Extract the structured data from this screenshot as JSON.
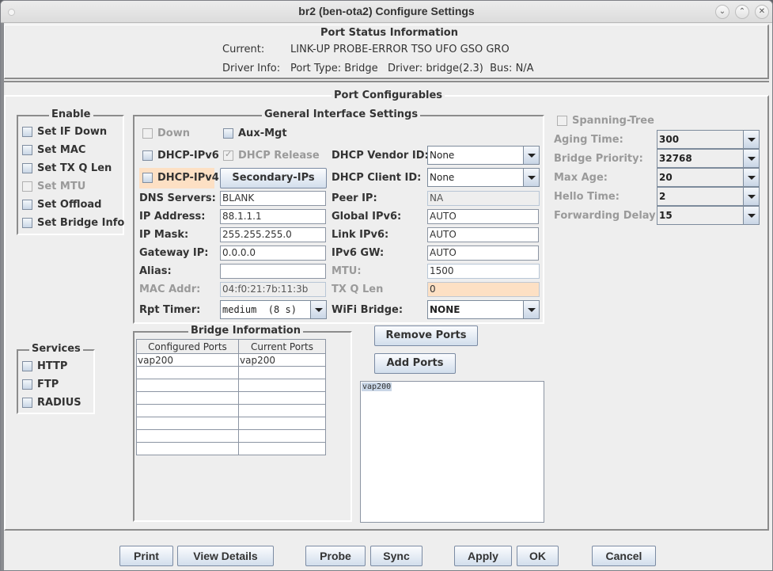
{
  "window": {
    "title": "br2  (ben-ota2) Configure Settings",
    "controls": {
      "minimize": "⌄",
      "maximize": "⌃",
      "close": "✕"
    }
  },
  "port_status": {
    "title": "Port Status Information",
    "current_label": "Current:",
    "current_value": "LINK-UP PROBE-ERROR TSO UFO GSO GRO",
    "driver_label": "Driver Info:",
    "driver_value": "Port Type: Bridge   Driver: bridge(2.3)  Bus: N/A"
  },
  "configurables": {
    "title": "Port Configurables",
    "enable": {
      "title": "Enable",
      "items": [
        {
          "label": "Set IF Down",
          "checked": false,
          "disabled": false
        },
        {
          "label": "Set MAC",
          "checked": false,
          "disabled": false
        },
        {
          "label": "Set TX Q Len",
          "checked": false,
          "disabled": false
        },
        {
          "label": "Set MTU",
          "checked": false,
          "disabled": true
        },
        {
          "label": "Set Offload",
          "checked": false,
          "disabled": false
        },
        {
          "label": "Set Bridge Info",
          "checked": false,
          "disabled": false
        }
      ]
    },
    "services": {
      "title": "Services",
      "items": [
        {
          "label": "HTTP",
          "checked": false
        },
        {
          "label": "FTP",
          "checked": false
        },
        {
          "label": "RADIUS",
          "checked": false
        }
      ]
    },
    "general": {
      "title": "General Interface Settings",
      "down": "Down",
      "aux_mgt": "Aux-Mgt",
      "dhcp_ipv6": "DHCP-IPv6",
      "dhcp_release": "DHCP Release",
      "dhcp_ipv4": "DHCP-IPv4",
      "secondary_ips": "Secondary-IPs",
      "dhcp_vendor_id_label": "DHCP Vendor ID:",
      "dhcp_vendor_id": "None",
      "dhcp_client_id_label": "DHCP Client ID:",
      "dhcp_client_id": "None",
      "dns_label": "DNS Servers:",
      "dns": "BLANK",
      "peer_ip_label": "Peer IP:",
      "peer_ip": "NA",
      "ip_label": "IP Address:",
      "ip": "88.1.1.1",
      "global_ipv6_label": "Global IPv6:",
      "global_ipv6": "AUTO",
      "mask_label": "IP Mask:",
      "mask": "255.255.255.0",
      "link_ipv6_label": "Link IPv6:",
      "link_ipv6": "AUTO",
      "gateway_label": "Gateway IP:",
      "gateway": "0.0.0.0",
      "ipv6_gw_label": "IPv6 GW:",
      "ipv6_gw": "AUTO",
      "alias_label": "Alias:",
      "alias": "",
      "mtu_label": "MTU:",
      "mtu": "1500",
      "mac_label": "MAC Addr:",
      "mac": "04:f0:21:7b:11:3b",
      "txq_label": "TX Q Len",
      "txq": "0",
      "rpt_timer_label": "Rpt Timer:",
      "rpt_timer": "medium  (8 s)",
      "wifi_bridge_label": "WiFi Bridge:",
      "wifi_bridge": "NONE"
    },
    "spanning_tree": {
      "label": "Spanning-Tree",
      "aging_time_label": "Aging Time:",
      "aging_time": "300",
      "bridge_priority_label": "Bridge Priority:",
      "bridge_priority": "32768",
      "max_age_label": "Max Age:",
      "max_age": "20",
      "hello_time_label": "Hello Time:",
      "hello_time": "2",
      "forwarding_delay_label": "Forwarding Delay:",
      "forwarding_delay": "15"
    },
    "bridge_info": {
      "title": "Bridge Information",
      "columns": [
        "Configured Ports",
        "Current Ports"
      ],
      "rows": [
        [
          "vap200",
          "vap200"
        ],
        [
          "",
          ""
        ],
        [
          "",
          ""
        ],
        [
          "",
          ""
        ],
        [
          "",
          ""
        ],
        [
          "",
          ""
        ],
        [
          "",
          ""
        ],
        [
          "",
          ""
        ]
      ],
      "remove_ports": "Remove Ports",
      "add_ports": "Add Ports",
      "available_ports": [
        "vap200"
      ]
    }
  },
  "footer": {
    "print": "Print",
    "view_details": "View Details",
    "probe": "Probe",
    "sync": "Sync",
    "apply": "Apply",
    "ok": "OK",
    "cancel": "Cancel"
  }
}
